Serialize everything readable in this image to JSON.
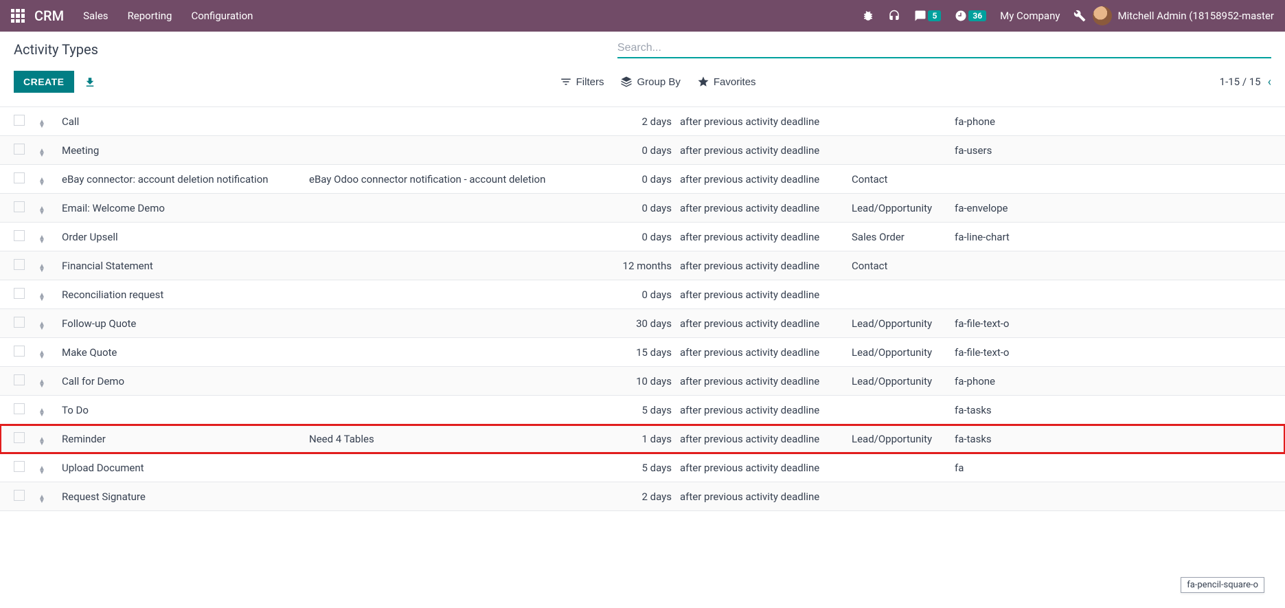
{
  "topbar": {
    "brand": "CRM",
    "nav": [
      "Sales",
      "Reporting",
      "Configuration"
    ],
    "messages_badge": "5",
    "clock_badge": "36",
    "company": "My Company",
    "user": "Mitchell Admin (18158952-master"
  },
  "page": {
    "title": "Activity Types",
    "search_placeholder": "Search...",
    "create_label": "CREATE",
    "filters_label": "Filters",
    "groupby_label": "Group By",
    "favorites_label": "Favorites",
    "pager": "1-15 / 15"
  },
  "rows": [
    {
      "name": "Call",
      "summary": "",
      "days": "2 days",
      "trigger": "after previous activity deadline",
      "model": "",
      "icon": "fa-phone",
      "hl": false
    },
    {
      "name": "Meeting",
      "summary": "",
      "days": "0 days",
      "trigger": "after previous activity deadline",
      "model": "",
      "icon": "fa-users",
      "hl": false
    },
    {
      "name": "eBay connector: account deletion notification",
      "summary": "eBay Odoo connector notification - account deletion",
      "days": "0 days",
      "trigger": "after previous activity deadline",
      "model": "Contact",
      "icon": "",
      "hl": false
    },
    {
      "name": "Email: Welcome Demo",
      "summary": "",
      "days": "0 days",
      "trigger": "after previous activity deadline",
      "model": "Lead/Opportunity",
      "icon": "fa-envelope",
      "hl": false
    },
    {
      "name": "Order Upsell",
      "summary": "",
      "days": "0 days",
      "trigger": "after previous activity deadline",
      "model": "Sales Order",
      "icon": "fa-line-chart",
      "hl": false
    },
    {
      "name": "Financial Statement",
      "summary": "",
      "days": "12 months",
      "trigger": "after previous activity deadline",
      "model": "Contact",
      "icon": "",
      "hl": false
    },
    {
      "name": "Reconciliation request",
      "summary": "",
      "days": "0 days",
      "trigger": "after previous activity deadline",
      "model": "",
      "icon": "",
      "hl": false
    },
    {
      "name": "Follow-up Quote",
      "summary": "",
      "days": "30 days",
      "trigger": "after previous activity deadline",
      "model": "Lead/Opportunity",
      "icon": "fa-file-text-o",
      "hl": false
    },
    {
      "name": "Make Quote",
      "summary": "",
      "days": "15 days",
      "trigger": "after previous activity deadline",
      "model": "Lead/Opportunity",
      "icon": "fa-file-text-o",
      "hl": false
    },
    {
      "name": "Call for Demo",
      "summary": "",
      "days": "10 days",
      "trigger": "after previous activity deadline",
      "model": "Lead/Opportunity",
      "icon": "fa-phone",
      "hl": false
    },
    {
      "name": "To Do",
      "summary": "",
      "days": "5 days",
      "trigger": "after previous activity deadline",
      "model": "",
      "icon": "fa-tasks",
      "hl": false
    },
    {
      "name": "Reminder",
      "summary": "Need 4 Tables",
      "days": "1 days",
      "trigger": "after previous activity deadline",
      "model": "Lead/Opportunity",
      "icon": "fa-tasks",
      "hl": true
    },
    {
      "name": "Upload Document",
      "summary": "",
      "days": "5 days",
      "trigger": "after previous activity deadline",
      "model": "",
      "icon": "fa",
      "hl": false
    },
    {
      "name": "Request Signature",
      "summary": "",
      "days": "2 days",
      "trigger": "after previous activity deadline",
      "model": "",
      "icon": "",
      "hl": false
    }
  ],
  "tooltip": "fa-pencil-square-o"
}
